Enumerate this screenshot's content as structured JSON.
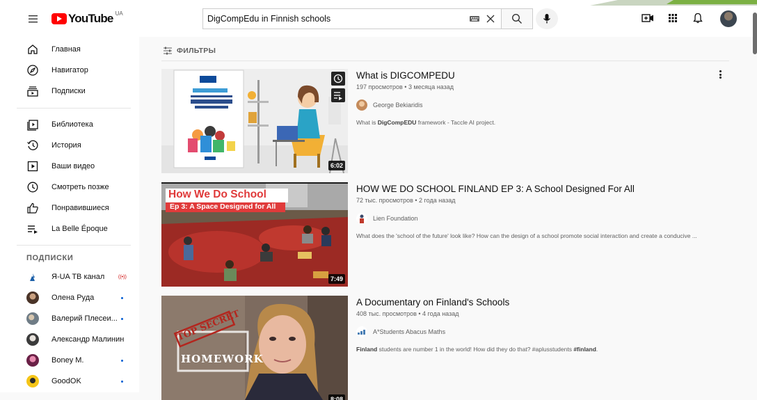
{
  "header": {
    "logo_text": "YouTube",
    "logo_region": "UA",
    "search_value": "DigCompEdu in Finnish schools",
    "accent_color": "#ff0000"
  },
  "sidebar": {
    "items": [
      {
        "label": "Главная",
        "icon": "home-icon"
      },
      {
        "label": "Навигатор",
        "icon": "compass-icon"
      },
      {
        "label": "Подписки",
        "icon": "subscriptions-icon"
      }
    ],
    "library_items": [
      {
        "label": "Библиотека",
        "icon": "library-icon"
      },
      {
        "label": "История",
        "icon": "history-icon"
      },
      {
        "label": "Ваши видео",
        "icon": "your-videos-icon"
      },
      {
        "label": "Смотреть позже",
        "icon": "watch-later-icon"
      },
      {
        "label": "Понравившиеся",
        "icon": "like-icon"
      },
      {
        "label": "La Belle Époque",
        "icon": "playlist-icon"
      }
    ],
    "subscriptions_title": "ПОДПИСКИ",
    "subscriptions": [
      {
        "label": "Я-UA ТВ канал",
        "status": "live"
      },
      {
        "label": "Олена Руда",
        "status": "new"
      },
      {
        "label": "Валерий Плесеи...",
        "status": "new"
      },
      {
        "label": "Александр Малинин",
        "status": ""
      },
      {
        "label": "Boney M.",
        "status": "new"
      },
      {
        "label": "GoodOK",
        "status": "new"
      }
    ]
  },
  "filters": {
    "label": "ФИЛЬТРЫ"
  },
  "results": [
    {
      "title": "What is DIGCOMPEDU",
      "meta": "197 просмотров • 3 месяца назад",
      "channel": "George Bekiaridis",
      "description_prefix": "What is ",
      "description_bold": "DigCompEDU",
      "description_suffix": " framework - Taccle AI project.",
      "duration": "6:02"
    },
    {
      "title": "HOW WE DO SCHOOL FINLAND EP 3: A School Designed For All",
      "meta": "72 тыс. просмотров • 2 года назад",
      "channel": "Lien Foundation",
      "description": "What does the 'school of the future' look like? How can the design of a school promote social interaction and create a conducive ...",
      "duration": "7:49",
      "thumb_title": "How We Do School",
      "thumb_subtitle": "Ep 3: A Space Designed for All"
    },
    {
      "title": "A Documentary on Finland's Schools",
      "meta": "408 тыс. просмотров • 4 года назад",
      "channel": "A*Students Abacus Maths",
      "description_bold1": "Finland",
      "description_mid": " students are number 1 in the world! How did they do that? #aplusstudents ",
      "description_bold2": "#finland",
      "description_end": ".",
      "duration": "8:08",
      "thumb_stamp": "TOP SECRET",
      "thumb_text": "HOMEWORK"
    }
  ]
}
